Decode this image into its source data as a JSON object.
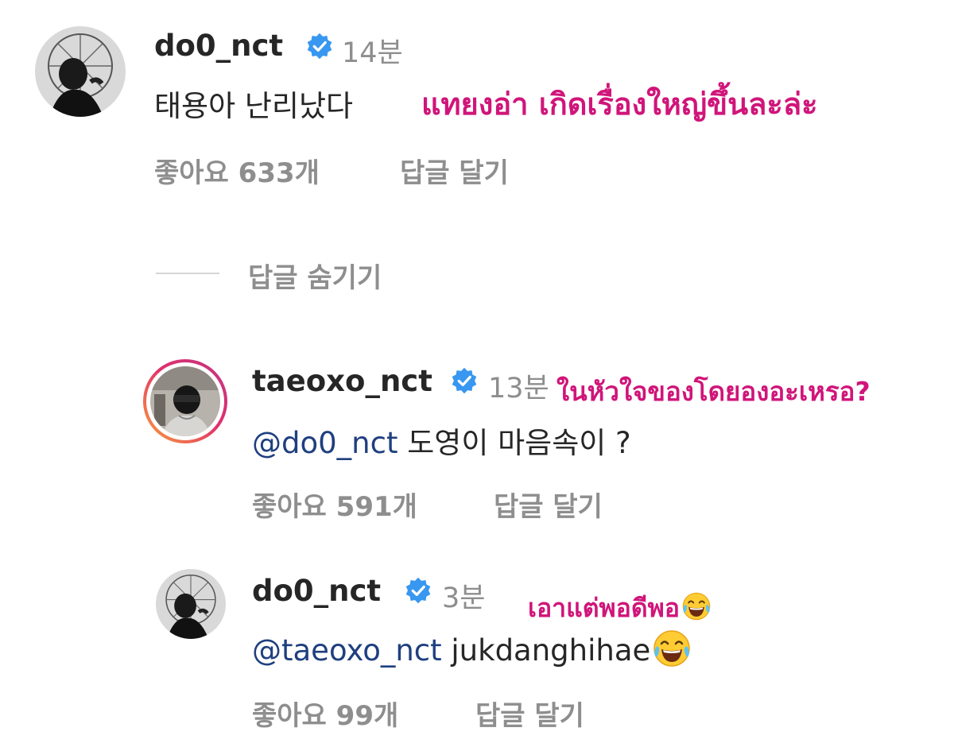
{
  "comment": {
    "username": "do0_nct",
    "time": "14분",
    "text": "태용아 난리났다",
    "translation": "แทยงอ่า เกิดเรื่องใหญ่ขึ้นละล่ะ",
    "likes": "좋아요 633개",
    "reply_label": "답글 달기"
  },
  "hide_replies_label": "답글 숨기기",
  "replies": [
    {
      "username": "taeoxo_nct",
      "time": "13분",
      "mention": "@do0_nct",
      "text": "도영이 마음속이 ?",
      "translation": "ในหัวใจของโดยองอะเหรอ?",
      "likes": "좋아요 591개",
      "reply_label": "답글 달기"
    },
    {
      "username": "do0_nct",
      "time": "3분",
      "mention": "@taeoxo_nct",
      "text": "jukdanghihae",
      "translation": "เอาแต่พอดีพอ",
      "likes": "좋아요 99개",
      "reply_label": "답글 달기"
    }
  ],
  "colors": {
    "verified": "#3897f0",
    "annotation": "#d0157a",
    "mention": "#1f3f7f",
    "muted": "#8e8e8e",
    "story_ring_start": "#f9a13a",
    "story_ring_end": "#c13584"
  },
  "icons": [
    "verified-badge-icon",
    "laughing-emoji-icon"
  ]
}
